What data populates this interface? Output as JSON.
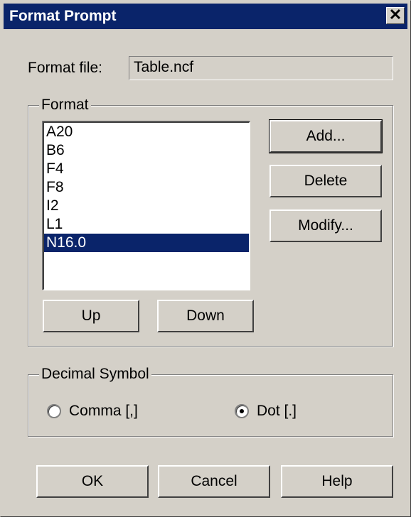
{
  "window": {
    "title": "Format Prompt",
    "close_glyph": "✕"
  },
  "format_file": {
    "label": "Format file:",
    "value": "Table.ncf"
  },
  "format_group": {
    "legend": "Format",
    "items": [
      "A20",
      "B6",
      "F4",
      "F8",
      "I2",
      "L1",
      "N16.0"
    ],
    "selected_index": 6,
    "buttons": {
      "add": "Add...",
      "delete": "Delete",
      "modify": "Modify...",
      "up": "Up",
      "down": "Down"
    }
  },
  "decimal_group": {
    "legend": "Decimal Symbol",
    "options": [
      {
        "label": "Comma [,]",
        "checked": false
      },
      {
        "label": "Dot [.]",
        "checked": true
      }
    ]
  },
  "footer": {
    "ok": "OK",
    "cancel": "Cancel",
    "help": "Help"
  },
  "colors": {
    "face": "#d4d0c8",
    "title_bar": "#0a246a",
    "selection": "#0a246a"
  }
}
